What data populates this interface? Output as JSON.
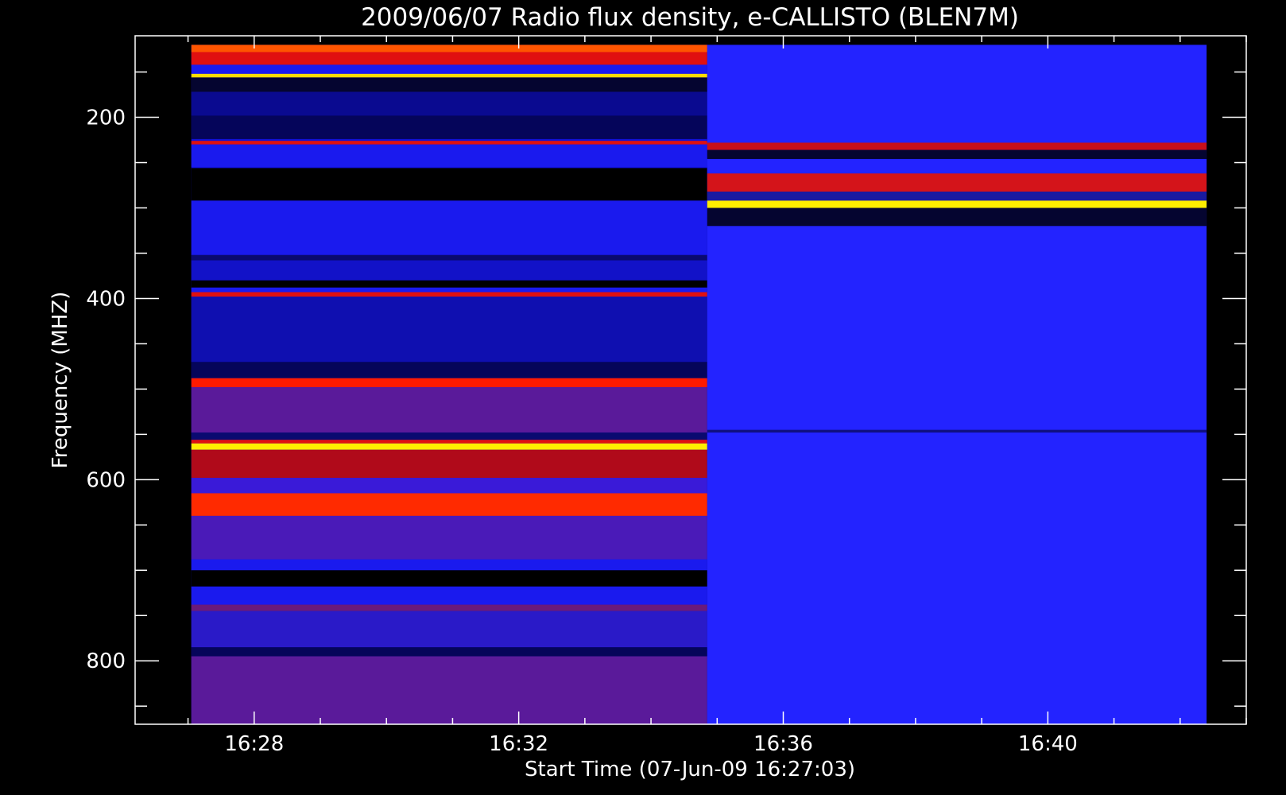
{
  "chart_data": {
    "type": "heatmap",
    "title": "2009/06/07  Radio flux density, e-CALLISTO (BLEN7M)",
    "xlabel": "Start Time (07-Jun-09 16:27:03)",
    "ylabel": "Frequency (MHZ)",
    "x_tick_labels": [
      "16:28",
      "16:32",
      "16:36",
      "16:40"
    ],
    "x_tick_minutes": [
      28,
      32,
      36,
      40
    ],
    "x_minor_step_min": 1,
    "xlim_minutes": [
      26.2,
      43.0
    ],
    "data_x_range_minutes": [
      27.05,
      42.4
    ],
    "x_break_minute": 34.85,
    "y_tick_labels": [
      "200",
      "400",
      "600",
      "800"
    ],
    "y_tick_values": [
      200,
      400,
      600,
      800
    ],
    "y_minor_step": 50,
    "ylim": [
      110,
      870
    ],
    "data_y_range": [
      120,
      870
    ],
    "grid": false,
    "colors": {
      "background": "#000000",
      "low": "#000000",
      "mid_low": "#0000ff",
      "mid": "#6a1aa0",
      "high": "#ff0000",
      "max": "#ffff00"
    },
    "segments": [
      {
        "time_range_minutes": [
          27.05,
          34.85
        ],
        "base_color": "#1010d8",
        "bands": [
          {
            "freq": [
              120,
              128
            ],
            "color": "#ff5500"
          },
          {
            "freq": [
              128,
              142
            ],
            "color": "#e01010"
          },
          {
            "freq": [
              142,
              152
            ],
            "color": "#1a1aee"
          },
          {
            "freq": [
              152,
              156
            ],
            "color": "#ffdd00"
          },
          {
            "freq": [
              156,
              172
            ],
            "color": "#050530"
          },
          {
            "freq": [
              172,
              198
            ],
            "color": "#0a0a90"
          },
          {
            "freq": [
              198,
              224
            ],
            "color": "#05055a"
          },
          {
            "freq": [
              226,
              230
            ],
            "color": "#e01010"
          },
          {
            "freq": [
              230,
              255
            ],
            "color": "#1a1aee"
          },
          {
            "freq": [
              256,
              292
            ],
            "color": "#000000"
          },
          {
            "freq": [
              292,
              352
            ],
            "color": "#1a1aee"
          },
          {
            "freq": [
              352,
              358
            ],
            "color": "#0a0a70"
          },
          {
            "freq": [
              358,
              380
            ],
            "color": "#1212c8"
          },
          {
            "freq": [
              380,
              388
            ],
            "color": "#000000"
          },
          {
            "freq": [
              388,
              393
            ],
            "color": "#1a1aee"
          },
          {
            "freq": [
              393,
              398
            ],
            "color": "#e01010"
          },
          {
            "freq": [
              398,
              470
            ],
            "color": "#0f0fb0"
          },
          {
            "freq": [
              470,
              488
            ],
            "color": "#05055a"
          },
          {
            "freq": [
              488,
              498
            ],
            "color": "#ff1a00"
          },
          {
            "freq": [
              498,
              548
            ],
            "color": "#5a1a9a"
          },
          {
            "freq": [
              548,
              556
            ],
            "color": "#0a0a70"
          },
          {
            "freq": [
              556,
              560
            ],
            "color": "#e01010"
          },
          {
            "freq": [
              560,
              567
            ],
            "color": "#ffee00"
          },
          {
            "freq": [
              567,
              598
            ],
            "color": "#b00a1a"
          },
          {
            "freq": [
              598,
              615
            ],
            "color": "#3a1ad8"
          },
          {
            "freq": [
              615,
              640
            ],
            "color": "#ff2a00"
          },
          {
            "freq": [
              640,
              688
            ],
            "color": "#4a1ab8"
          },
          {
            "freq": [
              688,
              700
            ],
            "color": "#1a1aee"
          },
          {
            "freq": [
              700,
              718
            ],
            "color": "#000000"
          },
          {
            "freq": [
              718,
              738
            ],
            "color": "#1a1aee"
          },
          {
            "freq": [
              738,
              745
            ],
            "color": "#6a1a7a"
          },
          {
            "freq": [
              745,
              785
            ],
            "color": "#2a1ac8"
          },
          {
            "freq": [
              785,
              795
            ],
            "color": "#05055a"
          },
          {
            "freq": [
              795,
              870
            ],
            "color": "#5a1a9a"
          }
        ]
      },
      {
        "time_range_minutes": [
          34.85,
          42.4
        ],
        "base_color": "#2323ff",
        "bands": [
          {
            "freq": [
              228,
              236
            ],
            "color": "#c8101a"
          },
          {
            "freq": [
              236,
              246
            ],
            "color": "#050530"
          },
          {
            "freq": [
              246,
              262
            ],
            "color": "#2323ff"
          },
          {
            "freq": [
              262,
              282
            ],
            "color": "#d4141a"
          },
          {
            "freq": [
              282,
              292
            ],
            "color": "#1a1aa0"
          },
          {
            "freq": [
              292,
              300
            ],
            "color": "#ffee00"
          },
          {
            "freq": [
              300,
              320
            ],
            "color": "#050530"
          },
          {
            "freq": [
              545,
              548
            ],
            "color": "#101080"
          }
        ]
      }
    ]
  }
}
